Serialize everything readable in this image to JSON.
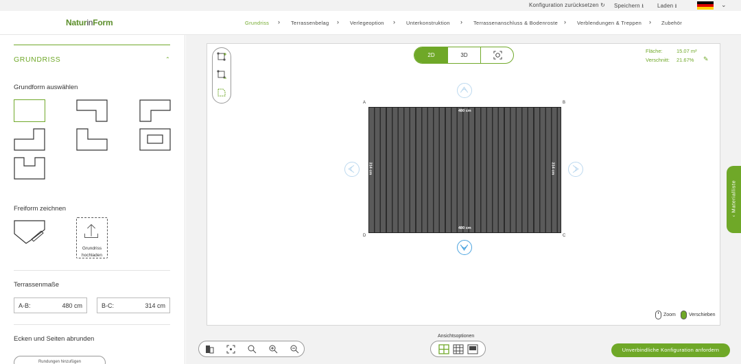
{
  "topbar": {
    "reset": "Konfiguration zurücksetzen ↻",
    "save": "Speichern ⭳",
    "load": "Laden ⭳",
    "language_flag": "de-flag-icon",
    "chevron": "chevron-down-icon"
  },
  "header": {
    "logo_a": "Natur",
    "logo_b": "in",
    "logo_c": "Form",
    "nav": [
      {
        "label": "Grundriss"
      },
      {
        "label": "Terrassenbelag"
      },
      {
        "label": "Verlegeoption"
      },
      {
        "label": "Unterkonstruktion"
      },
      {
        "label": "Terrassenanschluss & Bodenroste"
      },
      {
        "label": "Verblendungen & Treppen"
      },
      {
        "label": "Zubehör"
      }
    ]
  },
  "sidebar": {
    "section_title": "GRUNDRISS",
    "grundform_label": "Grundform auswählen",
    "freiform_label": "Freiform zeichnen",
    "upload_label_1": "Grundriss",
    "upload_label_2": "hochladen",
    "masse_label": "Terrassenmaße",
    "ab_label": "A-B:",
    "ab_value": "480 cm",
    "bc_label": "B-C:",
    "bc_value": "314 cm",
    "round_label": "Ecken und Seiten abrunden",
    "round_button": "Rundungen hinzufügen"
  },
  "canvas": {
    "view_2d": "2D",
    "view_3d": "3D",
    "area_label": "Fläche:",
    "area_value": "15.07 m²",
    "cut_label": "Verschnitt:",
    "cut_value": "21.67%",
    "corners": {
      "a": "A",
      "b": "B",
      "c": "C",
      "d": "D"
    },
    "dim_top": "480 cm",
    "dim_bottom": "480 cm",
    "dim_left": "314 cm",
    "dim_right": "314 cm",
    "zoom_label": "Zoom",
    "move_label": "Verschieben"
  },
  "bottom": {
    "ansicht_label": "Ansichtsoptionen",
    "cta": "Unverbindliche Konfiguration anfordern"
  },
  "material_tab": "Materialliste",
  "colors": {
    "accent": "#6fa828",
    "deck": "#555555",
    "arrow": "#4aa3df"
  }
}
